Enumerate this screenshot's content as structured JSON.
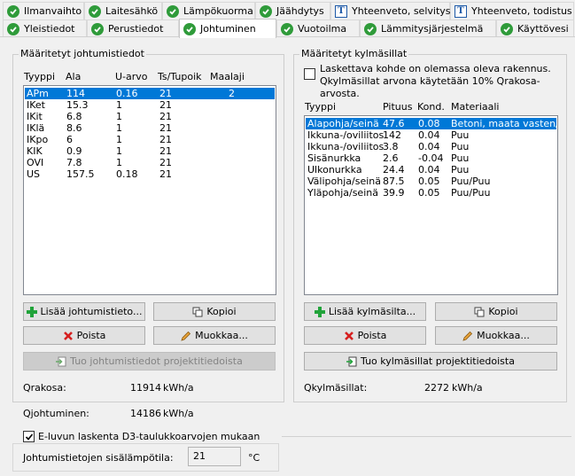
{
  "tabs_row1": [
    {
      "label": "Ilmanvaihto",
      "icon": "check-icon"
    },
    {
      "label": "Laitesähkö",
      "icon": "check-icon"
    },
    {
      "label": "Lämpökuorma",
      "icon": "check-icon"
    },
    {
      "label": "Jäähdytys",
      "icon": "check-icon"
    },
    {
      "label": "Yhteenveto, selvitys",
      "icon": "report-t-icon"
    },
    {
      "label": "Yhteenveto, todistus",
      "icon": "report-t-icon"
    }
  ],
  "tabs_row2": [
    {
      "label": "Yleistiedot",
      "icon": "check-icon"
    },
    {
      "label": "Perustiedot",
      "icon": "check-icon"
    },
    {
      "label": "Johtuminen",
      "icon": "check-icon"
    },
    {
      "label": "Vuotoilma",
      "icon": "check-icon"
    },
    {
      "label": "Lämmitysjärjestelmä",
      "icon": "check-icon"
    },
    {
      "label": "Käyttövesi",
      "icon": "check-icon"
    }
  ],
  "left": {
    "title": "Määritetyt johtumistiedot",
    "headers": [
      "Tyyppi",
      "Ala",
      "U-arvo",
      "Ts/Tupoik",
      "Maalaji"
    ],
    "rows": [
      [
        "APm",
        "114",
        "0.16",
        "21",
        "2"
      ],
      [
        "IKet",
        "15.3",
        "1",
        "21",
        ""
      ],
      [
        "IKit",
        "6.8",
        "1",
        "21",
        ""
      ],
      [
        "IKlä",
        "8.6",
        "1",
        "21",
        ""
      ],
      [
        "IKpo",
        "6",
        "1",
        "21",
        ""
      ],
      [
        "KIK",
        "0.9",
        "1",
        "21",
        ""
      ],
      [
        "OVI",
        "7.8",
        "1",
        "21",
        ""
      ],
      [
        "US",
        "157.5",
        "0.18",
        "21",
        ""
      ]
    ],
    "btn_add": "Lisää johtumistieto...",
    "btn_copy": "Kopioi",
    "btn_delete": "Poista",
    "btn_edit": "Muokkaa...",
    "btn_import": "Tuo johtumistiedot projektitiedoista",
    "result_label": "Qrakosa:",
    "result_value": "11914",
    "result_unit": "kWh/a"
  },
  "right": {
    "title": "Määritetyt kylmäsillat",
    "note": "Laskettava kohde on olemassa oleva rakennus. Qkylmäsillat arvona käytetään 10% Qrakosa-arvosta.",
    "headers": [
      "Tyyppi",
      "Pituus",
      "Kond.",
      "Materiaali"
    ],
    "rows": [
      [
        "Alapohja/seinä",
        "47.6",
        "0.08",
        "Betoni, maata vasten/Be"
      ],
      [
        "Ikkuna-/oviliitos",
        "142",
        "0.04",
        "Puu"
      ],
      [
        "Ikkuna-/oviliitos",
        "3.8",
        "0.04",
        "Puu"
      ],
      [
        "Sisänurkka",
        "2.6",
        "-0.04",
        "Puu"
      ],
      [
        "Ulkonurkka",
        "24.4",
        "0.04",
        "Puu"
      ],
      [
        "Välipohja/seinä",
        "87.5",
        "0.05",
        "Puu/Puu"
      ],
      [
        "Yläpohja/seinä",
        "39.9",
        "0.05",
        "Puu/Puu"
      ]
    ],
    "btn_add": "Lisää kylmäsilta...",
    "btn_copy": "Kopioi",
    "btn_delete": "Poista",
    "btn_edit": "Muokkaa...",
    "btn_import": "Tuo kylmäsillat projektitiedoista",
    "result_label": "Qkylmäsillat:",
    "result_value": "2272",
    "result_unit": "kWh/a"
  },
  "bottom": {
    "qjoht_label": "Qjohtuminen:",
    "qjoht_value": "14186",
    "qjoht_unit": "kWh/a",
    "checkbox_label": "E-luvun laskenta D3-taulukkoarvojen mukaan",
    "temp_label": "Johtumistietojen sisälämpötila:",
    "temp_value": "21",
    "temp_unit": "°C"
  }
}
